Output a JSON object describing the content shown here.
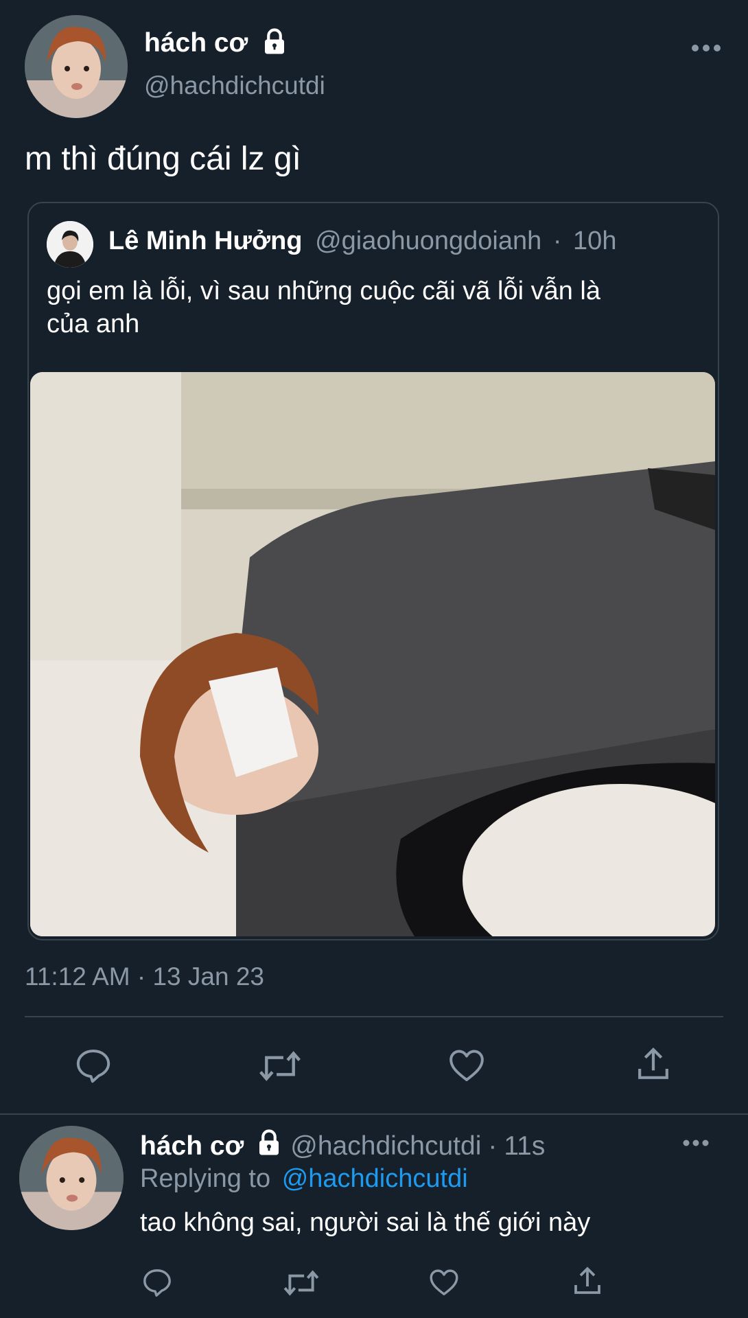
{
  "tweet": {
    "display_name": "hách cơ",
    "handle": "@hachdichcutdi",
    "text": "m thì đúng cái lz gì",
    "timestamp": "11:12 AM · 13 Jan 23",
    "more_icon": "more-horizontal-icon",
    "locked_icon": "lock-icon"
  },
  "quote": {
    "display_name": "Lê Minh Hưởng",
    "handle": "@giaohuongdoianh",
    "separator": "·",
    "time": "10h",
    "text_line1": "gọi em là lỗi, vì sau những cuộc cãi vã lỗi vẫn là",
    "text_line2": "của anh"
  },
  "actions": [
    "reply-icon",
    "retweet-icon",
    "like-icon",
    "share-icon"
  ],
  "reply": {
    "display_name": "hách cơ",
    "handle": "@hachdichcutdi",
    "separator": "·",
    "time": "11s",
    "replying_prefix": "Replying to",
    "replying_handle": "@hachdichcutdi",
    "text": "tao không sai, người sai là thế giới này"
  },
  "colors": {
    "background": "#15202b",
    "muted": "#8b98a5",
    "link": "#1d9bf0",
    "border": "#38444d"
  }
}
